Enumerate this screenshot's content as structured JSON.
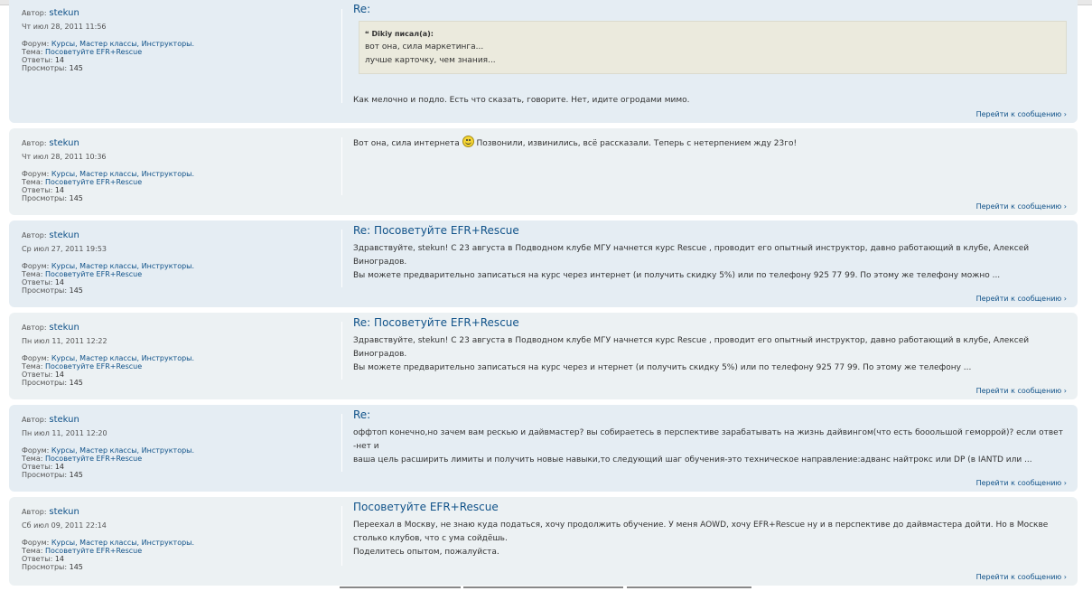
{
  "labels": {
    "author": "Автор:",
    "forum": "Форум:",
    "topic": "Тема:",
    "replies": "Ответы:",
    "views": "Просмотры:",
    "goto": "Перейти к сообщению"
  },
  "posts": [
    {
      "author": "stekun",
      "date": "Чт июл 28, 2011 11:56",
      "forum": "Курсы, Мастер классы, Инструкторы.",
      "topic": "Посоветуйте EFR+Rescue",
      "replies": "14",
      "views": "145",
      "title": "Re:",
      "quote_head": "Dikiy писал(а):",
      "quote_lines": [
        "вот она, сила маркетинга...",
        "лучше карточку, чем знания..."
      ],
      "body": "Как мелочно и подло. Есть что сказать, говорите. Нет, идите огродами мимо."
    },
    {
      "author": "stekun",
      "date": "Чт июл 28, 2011 10:36",
      "forum": "Курсы, Мастер классы, Инструкторы.",
      "topic": "Посоветуйте EFR+Rescue",
      "replies": "14",
      "views": "145",
      "body_a": "Вот она, сила интернета",
      "body_b": "Позвонили, извинились, всё рассказали. Теперь с нетерпением жду 23го!"
    },
    {
      "author": "stekun",
      "date": "Ср июл 27, 2011 19:53",
      "forum": "Курсы, Мастер классы, Инструкторы.",
      "topic": "Посоветуйте EFR+Rescue",
      "replies": "14",
      "views": "145",
      "title": "Re: Посоветуйте EFR+Rescue",
      "body_1": "Здравствуйте, stekun! С 23 августа в Подводном клубе МГУ начнется курс Rescue , проводит его опытный инструктор, давно работающий в клубе, Алексей Виноградов.",
      "body_2": "Вы можете предварительно записаться на курс через интернет (и получить скидку 5%) или по телефону 925 77 99. По этому же телефону можно ..."
    },
    {
      "author": "stekun",
      "date": "Пн июл 11, 2011 12:22",
      "forum": "Курсы, Мастер классы, Инструкторы.",
      "topic": "Посоветуйте EFR+Rescue",
      "replies": "14",
      "views": "145",
      "title": "Re: Посоветуйте EFR+Rescue",
      "body_1": "Здравствуйте, stekun! С 23 августа в Подводном клубе МГУ начнется курс Rescue , проводит его опытный инструктор, давно работающий в клубе, Алексей Виноградов.",
      "body_2": "Вы можете предварительно записаться на курс через и нтернет (и получить скидку 5%) или по телефону 925 77 99. По этому же телефону ..."
    },
    {
      "author": "stekun",
      "date": "Пн июл 11, 2011 12:20",
      "forum": "Курсы, Мастер классы, Инструкторы.",
      "topic": "Посоветуйте EFR+Rescue",
      "replies": "14",
      "views": "145",
      "title": "Re:",
      "body_1": "оффтоп конечно,но зачем вам рескью и дайвмастер? вы собираетесь в перспективе зарабатывать на жизнь дайвингом(что есть бооольшой геморрой)? если ответ -нет и",
      "body_2": "ваша цель расширить лимиты и получить новые навыки,то следующий шаг обучения-это техническое направление:адванс найтрокс или DP (в IANTD или ..."
    },
    {
      "author": "stekun",
      "date": "Сб июл 09, 2011 22:14",
      "forum": "Курсы, Мастер классы, Инструкторы.",
      "topic": "Посоветуйте EFR+Rescue",
      "replies": "14",
      "views": "145",
      "title": "Посоветуйте EFR+Rescue",
      "body_1": "Переехал в Москву, не знаю куда податься, хочу продолжить обучение. У меня AOWD, хочу EFR+Rescue ну и в перспективе до дайвмастера дойти. Но в Москве",
      "body_2": "столько клубов, что с ума сойдёшь.",
      "body_3": "Поделитесь опытом, пожалуйста."
    }
  ]
}
